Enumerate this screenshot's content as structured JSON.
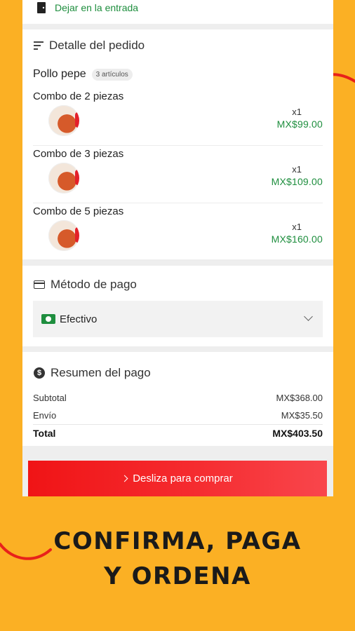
{
  "delivery": {
    "instruction": "Dejar en la entrada"
  },
  "order": {
    "title": "Detalle del pedido",
    "restaurant": "Pollo pepe",
    "items_count": "3 artículos",
    "items": [
      {
        "name": "Combo de 2 piezas",
        "qty": "x1",
        "price": "MX$99.00"
      },
      {
        "name": "Combo de 3 piezas",
        "qty": "x1",
        "price": "MX$109.00"
      },
      {
        "name": "Combo de 5 piezas",
        "qty": "x1",
        "price": "MX$160.00"
      }
    ]
  },
  "payment": {
    "title": "Método de pago",
    "selected": "Efectivo"
  },
  "summary": {
    "title": "Resumen del pago",
    "rows": [
      {
        "label": "Subtotal",
        "value": "MX$368.00"
      },
      {
        "label": "Envío",
        "value": "MX$35.50"
      },
      {
        "label": "Total",
        "value": "MX$403.50"
      }
    ]
  },
  "cta": {
    "label": "Desliza para comprar"
  },
  "promo": {
    "line1": "CONFIRMA, PAGA",
    "line2": "Y ORDENA"
  },
  "colors": {
    "background": "#FBB024",
    "accent_green": "#1E8E3E",
    "button_red": "#F01416",
    "swoosh_red": "#E8211A"
  },
  "icons": [
    "door-icon",
    "list-icon",
    "credit-card-icon",
    "cash-icon",
    "chevron-down-icon",
    "dollar-circle-icon",
    "chevron-right-icon"
  ]
}
